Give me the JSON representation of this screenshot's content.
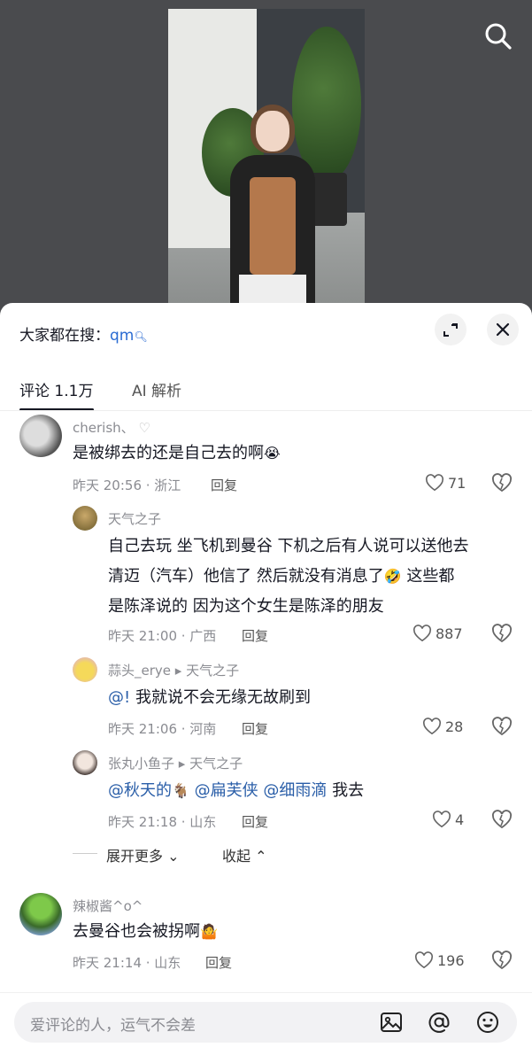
{
  "hot_search": {
    "label": "大家都在搜：",
    "keyword": "qm"
  },
  "tabs": {
    "comments": "评论 1.1万",
    "ai": "AI 解析"
  },
  "comments": [
    {
      "user": "cherish、",
      "text": "是被绑去的还是自己去的啊",
      "time": "昨天 20:56 · 浙江",
      "reply": "回复",
      "likes": "71"
    },
    {
      "user": "辣椒酱^o^",
      "text": "去曼谷也会被拐啊",
      "time": "昨天 21:14 · 山东",
      "reply": "回复",
      "likes": "196"
    }
  ],
  "replies": [
    {
      "user": "天气之子",
      "line1": "自己去玩 坐飞机到曼谷 下机之后有人说可以送他去",
      "line2": "清迈（汽车）他信了 然后就没有消息了",
      "line3": "这些都",
      "line4": "是陈泽说的 因为这个女生是陈泽的朋友",
      "time": "昨天 21:00 · 广西",
      "reply": "回复",
      "likes": "887"
    },
    {
      "user": "蒜头_erye",
      "arrow": "▸",
      "to": "天气之子",
      "text_prefix": "@!",
      "text": "我就说不会无缘无故刷到",
      "time": "昨天 21:06 · 河南",
      "reply": "回复",
      "likes": "28"
    },
    {
      "user": "张丸小鱼子",
      "arrow": "▸",
      "to": "天气之子",
      "m1": "@秋天的",
      "m2": "@扁芙侠",
      "m3": "@细雨滴",
      "tail": "我去",
      "time": "昨天 21:18 · 山东",
      "reply": "回复",
      "likes": "4"
    }
  ],
  "thread_actions": {
    "expand": "展开更多",
    "collapse": "收起"
  },
  "bottom": {
    "placeholder": "爱评论的人，运气不会差"
  },
  "colors": {
    "mention": "#2a5ea8",
    "meta": "#8a8b91",
    "keyword": "#2a6bd2"
  },
  "icons": [
    "search-icon",
    "expand-icon",
    "close-icon",
    "heart-icon",
    "dislike-icon",
    "image-icon",
    "at-icon",
    "emoji-icon"
  ]
}
